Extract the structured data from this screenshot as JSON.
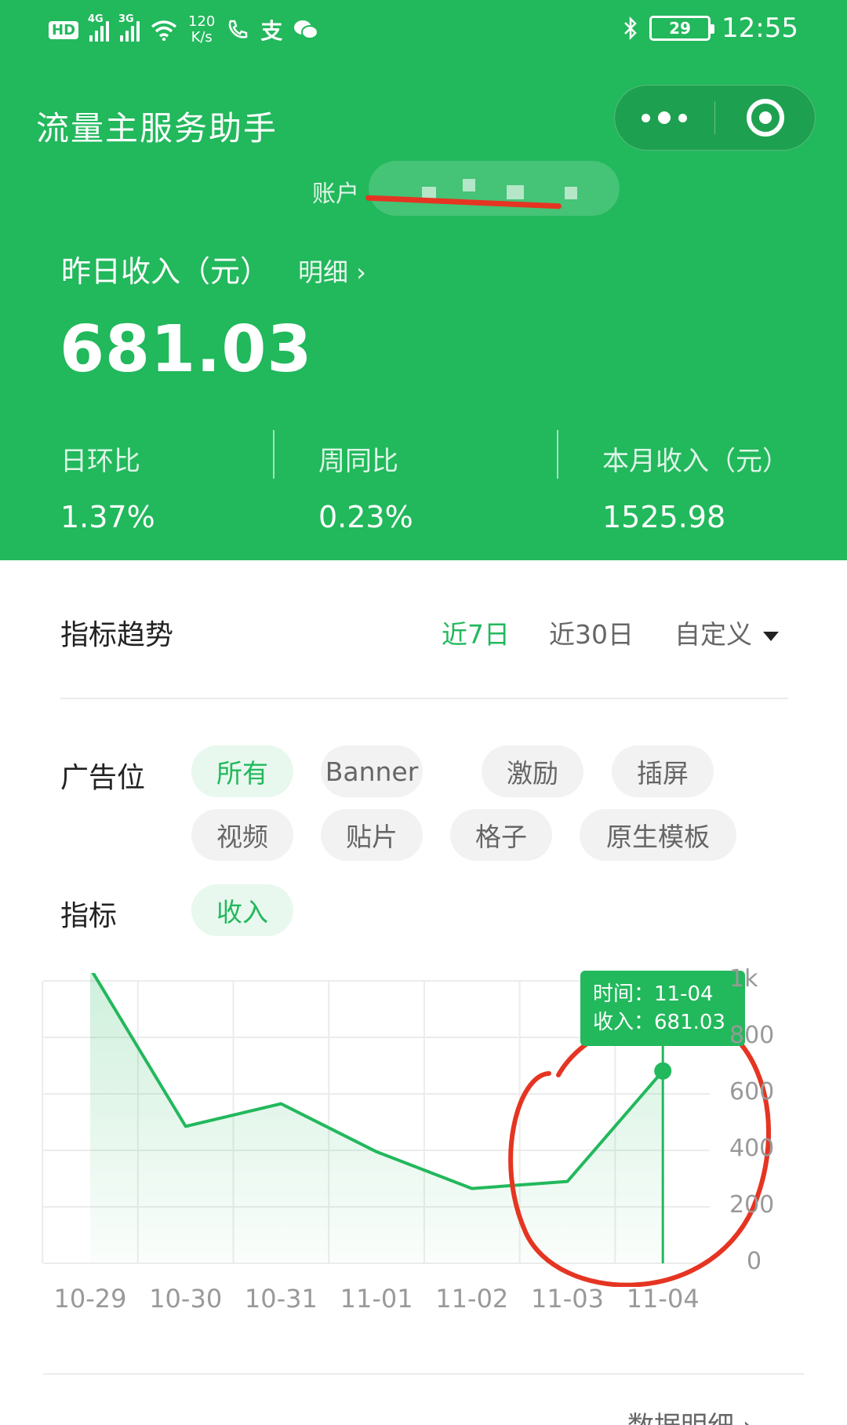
{
  "status_bar": {
    "hd": "HD",
    "sim1_gen": "4G",
    "sim2_gen": "3G",
    "net_speed_value": "120",
    "net_speed_unit": "K/s",
    "battery": "29",
    "time": "12:55",
    "icons": [
      "hd-icon",
      "signal-icon",
      "wifi-icon",
      "call-icon",
      "alipay-icon",
      "wechat-icon",
      "bluetooth-icon",
      "battery-icon"
    ]
  },
  "app": {
    "title": "流量主服务助手",
    "more_icon": "more-dots-icon",
    "close_icon": "target-circle-icon"
  },
  "account": {
    "label": "账户"
  },
  "summary": {
    "yesterday_label": "昨日收入（元）",
    "detail_link": "明细 ›",
    "yesterday_value": "681.03",
    "metrics": [
      {
        "label": "日环比",
        "value": "1.37%"
      },
      {
        "label": "周同比",
        "value": "0.23%"
      },
      {
        "label": "本月收入（元）",
        "value": "1525.98"
      }
    ]
  },
  "trend": {
    "title": "指标趋势",
    "ranges": [
      "近7日",
      "近30日",
      "自定义"
    ],
    "active_range": "近7日",
    "ad_position_label": "广告位",
    "ad_positions": [
      "所有",
      "Banner",
      "激励",
      "插屏",
      "视频",
      "贴片",
      "格子",
      "原生模板"
    ],
    "ad_position_selected": "所有",
    "metric_label": "指标",
    "metric_options": [
      "收入"
    ],
    "metric_selected": "收入"
  },
  "tooltip": {
    "time_line": "时间：11-04",
    "value_line": "收入：681.03"
  },
  "chart_data": {
    "type": "area",
    "categories": [
      "10-29",
      "10-30",
      "10-31",
      "11-01",
      "11-02",
      "11-03",
      "11-04"
    ],
    "series": [
      {
        "name": "收入",
        "values": [
          1045,
          485,
          565,
          395,
          265,
          290,
          681.03
        ]
      }
    ],
    "yticks": [
      "0",
      "200",
      "400",
      "600",
      "800",
      "1k"
    ],
    "ylim": [
      0,
      1000
    ],
    "highlight_index": 6,
    "grid": true,
    "colors": {
      "line": "#22b85c",
      "grid": "#ececec",
      "label": "#999999"
    }
  },
  "footer": {
    "data_detail": "数据明细 ›"
  },
  "annotation_color": "#e53522"
}
